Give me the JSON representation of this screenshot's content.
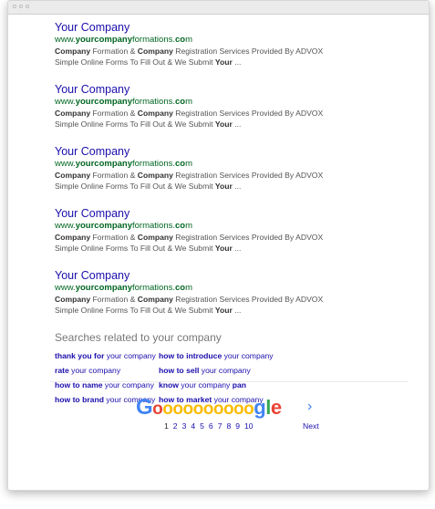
{
  "window": {
    "controls": [
      "close",
      "minimize",
      "maximize"
    ]
  },
  "results": [
    {
      "title": "Your Company",
      "url_pre": "www.",
      "url_bold": "yourcompany",
      "url_mid": "formations.",
      "url_bold2": "co",
      "url_post": "m",
      "snippet_line1": [
        {
          "text": "Company",
          "bold": true
        },
        {
          "text": " Formation & ",
          "bold": false
        },
        {
          "text": "Company",
          "bold": true
        },
        {
          "text": " Registration Services Provided By ADVOX",
          "bold": false
        }
      ],
      "snippet_line2": [
        {
          "text": "Simple Online Forms To Fill Out & We Submit ",
          "bold": false
        },
        {
          "text": "Your",
          "bold": true
        },
        {
          "text": " ...",
          "bold": false
        }
      ]
    },
    {
      "title": "Your Company",
      "url_pre": "www.",
      "url_bold": "yourcompany",
      "url_mid": "formations.",
      "url_bold2": "co",
      "url_post": "m",
      "snippet_line1": [
        {
          "text": "Company",
          "bold": true
        },
        {
          "text": " Formation & ",
          "bold": false
        },
        {
          "text": "Company",
          "bold": true
        },
        {
          "text": " Registration Services Provided By ADVOX",
          "bold": false
        }
      ],
      "snippet_line2": [
        {
          "text": "Simple Online Forms To Fill Out & We Submit ",
          "bold": false
        },
        {
          "text": "Your",
          "bold": true
        },
        {
          "text": " ...",
          "bold": false
        }
      ]
    },
    {
      "title": "Your Company",
      "url_pre": "www.",
      "url_bold": "yourcompany",
      "url_mid": "formations.",
      "url_bold2": "co",
      "url_post": "m",
      "snippet_line1": [
        {
          "text": "Company",
          "bold": true
        },
        {
          "text": " Formation & ",
          "bold": false
        },
        {
          "text": "Company",
          "bold": true
        },
        {
          "text": " Registration Services Provided By ADVOX",
          "bold": false
        }
      ],
      "snippet_line2": [
        {
          "text": "Simple Online Forms To Fill Out & We Submit ",
          "bold": false
        },
        {
          "text": "Your",
          "bold": true
        },
        {
          "text": " ...",
          "bold": false
        }
      ]
    },
    {
      "title": "Your Company",
      "url_pre": "www.",
      "url_bold": "yourcompany",
      "url_mid": "formations.",
      "url_bold2": "co",
      "url_post": "m",
      "snippet_line1": [
        {
          "text": "Company",
          "bold": true
        },
        {
          "text": " Formation & ",
          "bold": false
        },
        {
          "text": "Company",
          "bold": true
        },
        {
          "text": " Registration Services Provided By ADVOX",
          "bold": false
        }
      ],
      "snippet_line2": [
        {
          "text": "Simple Online Forms To Fill Out & We Submit ",
          "bold": false
        },
        {
          "text": "Your",
          "bold": true
        },
        {
          "text": " ...",
          "bold": false
        }
      ]
    },
    {
      "title": "Your Company",
      "url_pre": "www.",
      "url_bold": "yourcompany",
      "url_mid": "formations.",
      "url_bold2": "co",
      "url_post": "m",
      "snippet_line1": [
        {
          "text": "Company",
          "bold": true
        },
        {
          "text": " Formation & ",
          "bold": false
        },
        {
          "text": "Company",
          "bold": true
        },
        {
          "text": " Registration Services Provided By ADVOX",
          "bold": false
        }
      ],
      "snippet_line2": [
        {
          "text": "Simple Online Forms To Fill Out & We Submit ",
          "bold": false
        },
        {
          "text": "Your",
          "bold": true
        },
        {
          "text": " ...",
          "bold": false
        }
      ]
    }
  ],
  "related": {
    "heading": "Searches related to your company",
    "links": [
      {
        "bold": "thank you for",
        "rest": " your company"
      },
      {
        "bold": "how to introduce",
        "rest": " your company"
      },
      {
        "bold": "rate",
        "rest": " your company"
      },
      {
        "bold": "how to sell",
        "rest": " your company"
      },
      {
        "bold": "how to name",
        "rest": " your company"
      },
      {
        "bold": "know",
        "rest": " your company ",
        "bold2": "pan"
      },
      {
        "bold": "how to brand",
        "rest": " your company"
      },
      {
        "bold": "how to market",
        "rest": " your company"
      }
    ]
  },
  "pagination": {
    "logo_letters": [
      {
        "ch": "G",
        "color": "#4285f4",
        "big": true
      },
      {
        "ch": "o",
        "color": "#ea4335"
      },
      {
        "ch": "o",
        "color": "#fbbc05"
      },
      {
        "ch": "o",
        "color": "#fbbc05"
      },
      {
        "ch": "o",
        "color": "#fbbc05"
      },
      {
        "ch": "o",
        "color": "#fbbc05"
      },
      {
        "ch": "o",
        "color": "#fbbc05"
      },
      {
        "ch": "o",
        "color": "#fbbc05"
      },
      {
        "ch": "o",
        "color": "#fbbc05"
      },
      {
        "ch": "o",
        "color": "#fbbc05"
      },
      {
        "ch": "o",
        "color": "#fbbc05"
      },
      {
        "ch": "g",
        "color": "#4285f4"
      },
      {
        "ch": "l",
        "color": "#34a853"
      },
      {
        "ch": "e",
        "color": "#ea4335"
      }
    ],
    "arrow": "›",
    "pages": [
      "1",
      "2",
      "3",
      "4",
      "5",
      "6",
      "7",
      "8",
      "9",
      "10"
    ],
    "current_page": "1",
    "next_label": "Next"
  },
  "colors": {
    "link": "#1a0dab",
    "url_green": "#006621",
    "snippet": "#545454"
  }
}
